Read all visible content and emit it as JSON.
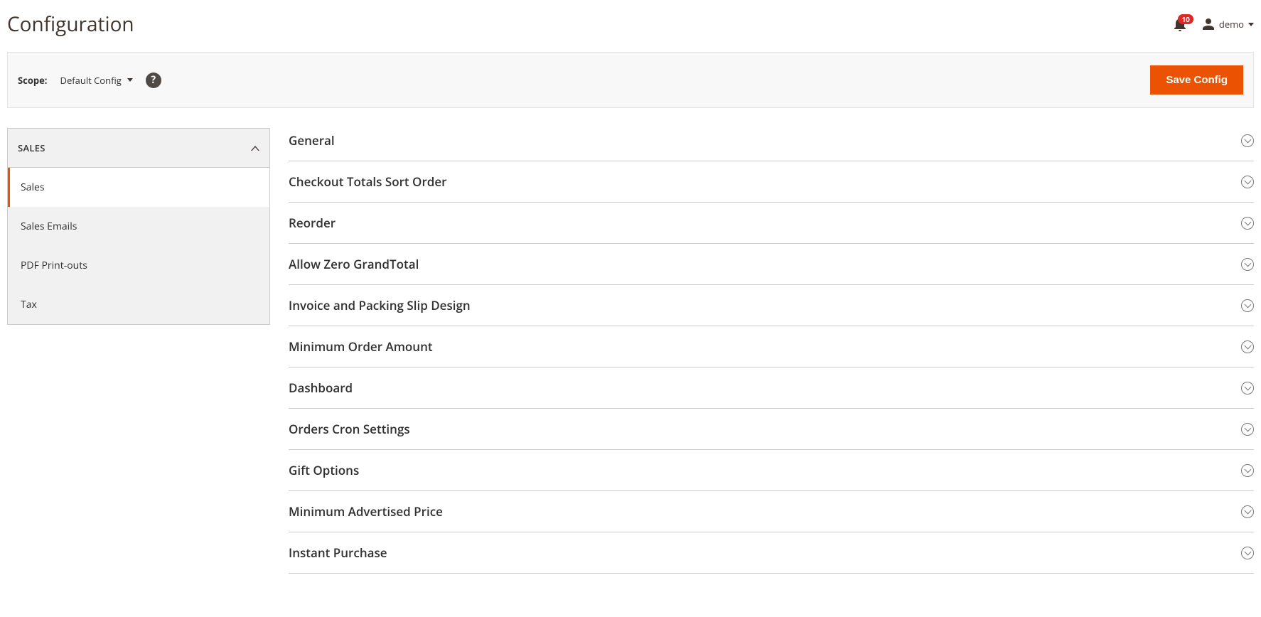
{
  "header": {
    "title": "Configuration",
    "notification_count": "10",
    "username": "demo"
  },
  "toolbar": {
    "scope_label": "Scope:",
    "scope_value": "Default Config",
    "save_label": "Save Config"
  },
  "sidebar": {
    "group_label": "SALES",
    "items": [
      {
        "label": "Sales",
        "active": true
      },
      {
        "label": "Sales Emails",
        "active": false
      },
      {
        "label": "PDF Print-outs",
        "active": false
      },
      {
        "label": "Tax",
        "active": false
      }
    ]
  },
  "sections": [
    {
      "title": "General"
    },
    {
      "title": "Checkout Totals Sort Order"
    },
    {
      "title": "Reorder"
    },
    {
      "title": "Allow Zero GrandTotal"
    },
    {
      "title": "Invoice and Packing Slip Design"
    },
    {
      "title": "Minimum Order Amount"
    },
    {
      "title": "Dashboard"
    },
    {
      "title": "Orders Cron Settings"
    },
    {
      "title": "Gift Options"
    },
    {
      "title": "Minimum Advertised Price"
    },
    {
      "title": "Instant Purchase"
    }
  ]
}
